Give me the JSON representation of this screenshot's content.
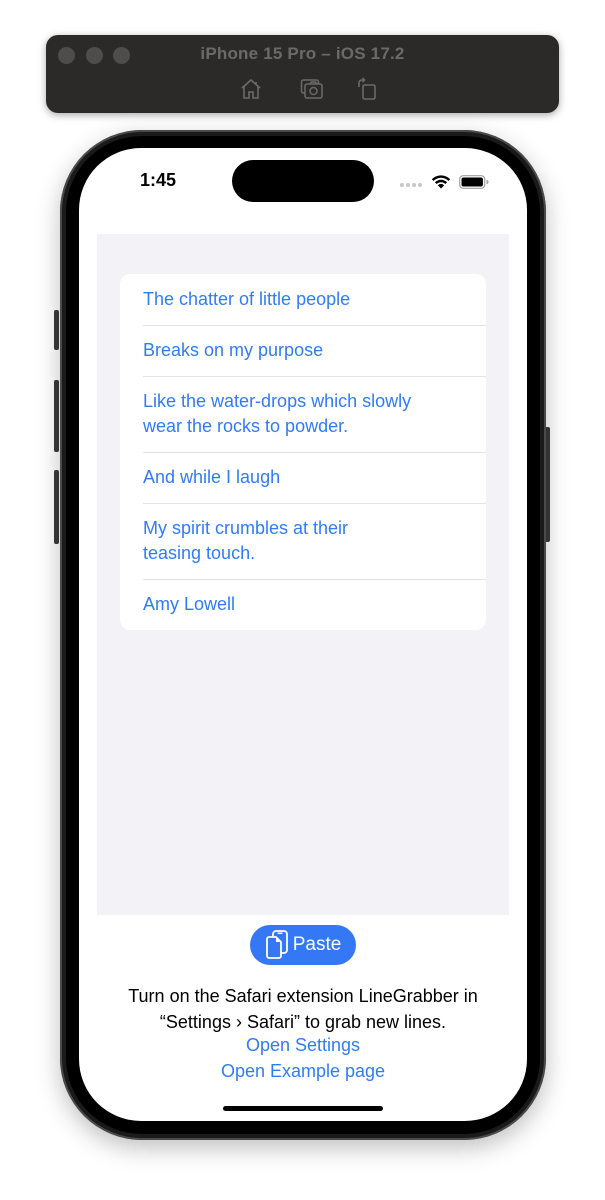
{
  "simulator": {
    "title": "iPhone 15 Pro – iOS 17.2",
    "toolbar": [
      {
        "name": "home",
        "icon": "home-icon"
      },
      {
        "name": "screenshot",
        "icon": "camera-icon"
      },
      {
        "name": "rotate",
        "icon": "rotate-icon"
      }
    ]
  },
  "status_bar": {
    "time": "1:45",
    "wifi": "wifi-icon",
    "battery": "battery-icon"
  },
  "lines": [
    {
      "text": "The chatter of little people"
    },
    {
      "text": "Breaks on my purpose"
    },
    {
      "text": "Like the water-drops which slowly wear the rocks to powder."
    },
    {
      "text": "And while I laugh"
    },
    {
      "text": "My spirit crumbles at their teasing touch."
    },
    {
      "text": "Amy Lowell"
    }
  ],
  "paste_button": {
    "label": "Paste",
    "icon": "paste-icon"
  },
  "info": {
    "message": "Turn on the Safari extension LineGrabber in “Settings › Safari” to grab new lines.",
    "open_settings": "Open Settings",
    "open_example": "Open Example page"
  },
  "colors": {
    "accent": "#2f7cf6",
    "button": "#3478f6",
    "grouped_background": "#f2f2f7"
  }
}
